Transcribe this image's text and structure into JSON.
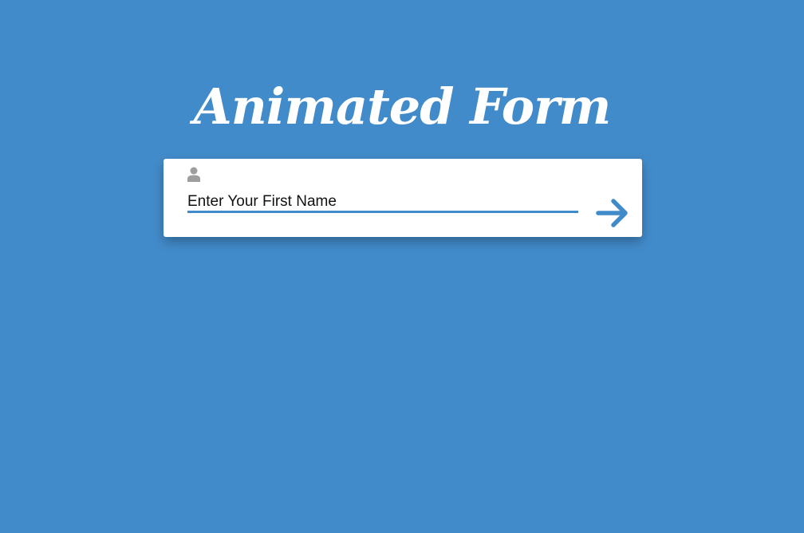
{
  "page": {
    "title": "Animated Form",
    "background_color": "#428bca"
  },
  "form": {
    "field_label": "Enter Your First Name",
    "field_value": "",
    "field_icon": "user-icon",
    "submit_icon": "arrow-right-icon",
    "accent_color": "#428bca"
  }
}
